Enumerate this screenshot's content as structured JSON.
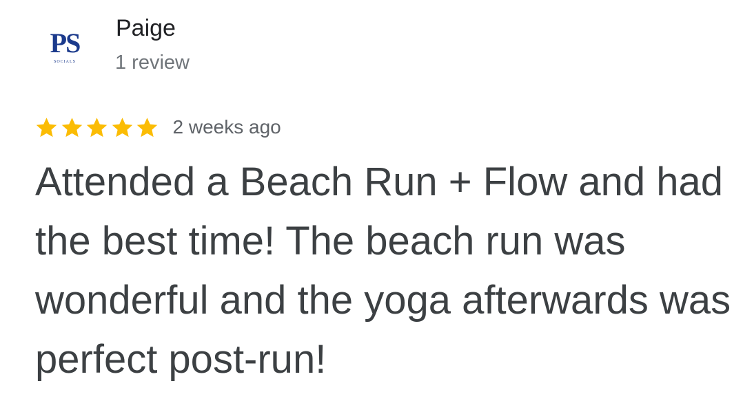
{
  "review": {
    "author": {
      "name": "Paige",
      "review_count": "1 review",
      "avatar_logo": {
        "mark": "PS",
        "tagline": "SOCIALS",
        "color": "#1b3a8c"
      }
    },
    "rating": {
      "value": 5,
      "max": 5,
      "star_color": "#fbbc04"
    },
    "time": "2 weeks ago",
    "text": "Attended a Beach Run + Flow and had the best time! The beach run was wonderful and the yoga afterwards was perfect post-run!"
  }
}
